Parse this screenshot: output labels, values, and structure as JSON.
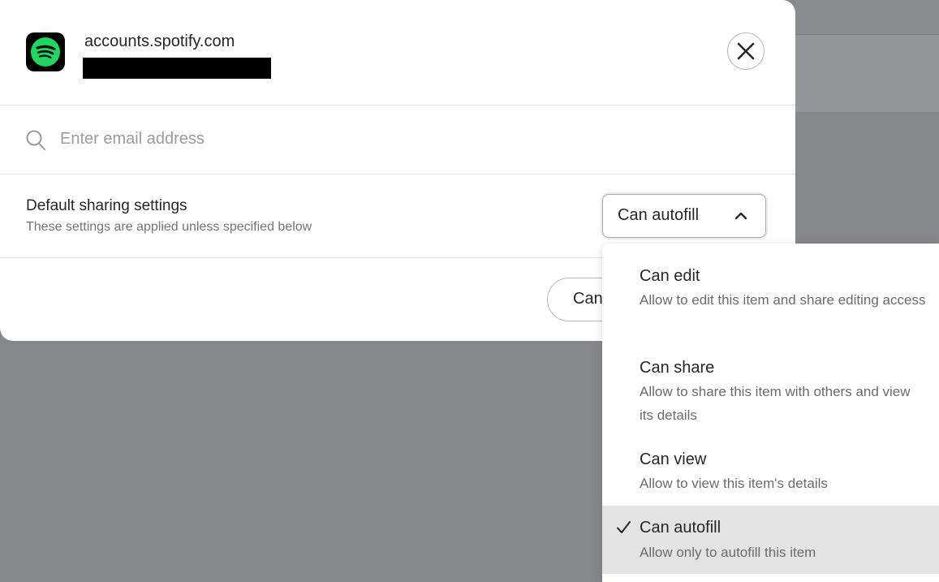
{
  "header": {
    "site": "accounts.spotify.com",
    "close_label": "Close"
  },
  "search": {
    "placeholder": "Enter email address"
  },
  "default_sharing": {
    "title": "Default sharing settings",
    "subtitle": "These settings are applied unless specified below",
    "selected": "Can autofill"
  },
  "footer": {
    "button_partial": "Can"
  },
  "dropdown": {
    "options": [
      {
        "title": "Can edit",
        "description": "Allow to edit this item and share editing access",
        "selected": false
      },
      {
        "title": "Can share",
        "description": "Allow to share this item with others and view its details",
        "selected": false
      },
      {
        "title": "Can view",
        "description": "Allow to view this item's details",
        "selected": false
      },
      {
        "title": "Can autofill",
        "description": "Allow only to autofill this item",
        "selected": true
      }
    ]
  },
  "colors": {
    "spotify_green": "#1ed760",
    "overlay": "#86878b",
    "selected_row": "#e3e3e3"
  },
  "icons": [
    "spotify-logo",
    "close-icon",
    "search-icon",
    "chevron-up-icon",
    "check-icon"
  ]
}
